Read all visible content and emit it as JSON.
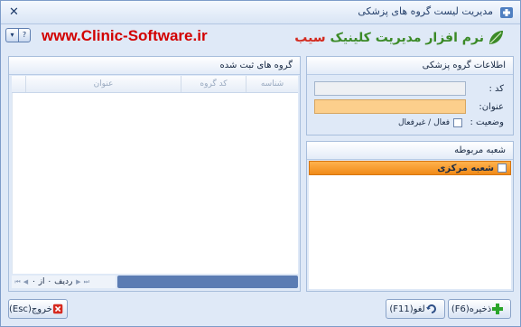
{
  "window": {
    "title": "مدیریت لیست گروه های پزشکی",
    "close_glyph": "✕"
  },
  "header": {
    "site_url": "www.Clinic-Software.ir",
    "logo_text": "نرم افزار مدیریت کلینیک",
    "logo_accent": "سیب",
    "help_glyph": "?",
    "dropdown_glyph": "▾"
  },
  "grid_panel": {
    "title": "گروه های ثبت شده",
    "columns": [
      "شناسه",
      "کد گروه",
      "عنوان"
    ],
    "rows": [],
    "navigator": {
      "label": "ردیف ۰ از ۰",
      "first_glyph": "⏮",
      "prev_glyph": "◀",
      "next_glyph": "▶",
      "last_glyph": "⏭"
    }
  },
  "info_panel": {
    "title": "اطلاعات گروه پزشکی",
    "code_label": "کد :",
    "code_value": "",
    "title_label": "عنوان:",
    "title_value": "",
    "status_label": "وضعیت :",
    "status_checkbox_label": "فعال / غیرفعال",
    "status_checked": false
  },
  "branch_panel": {
    "title": "شعبه مربوطه",
    "items": [
      {
        "label": "شعبه مرکزی",
        "checked": false
      }
    ]
  },
  "buttons": {
    "save": "ذخیره(F6)",
    "undo": "لغو(F11)",
    "exit": "خروج(Esc)"
  },
  "colors": {
    "window_bg": "#dfe9f7",
    "url_red": "#d20000",
    "logo_green": "#3b8a27",
    "required_field": "#fccf8c",
    "selected_row": "#f5a033",
    "save_icon_green": "#2aa52a",
    "exit_icon_red": "#d62a1f"
  },
  "icons": {
    "window": "medical-group-icon",
    "save": "plus-icon",
    "undo": "undo-arrow-icon",
    "exit": "close-x-icon"
  }
}
